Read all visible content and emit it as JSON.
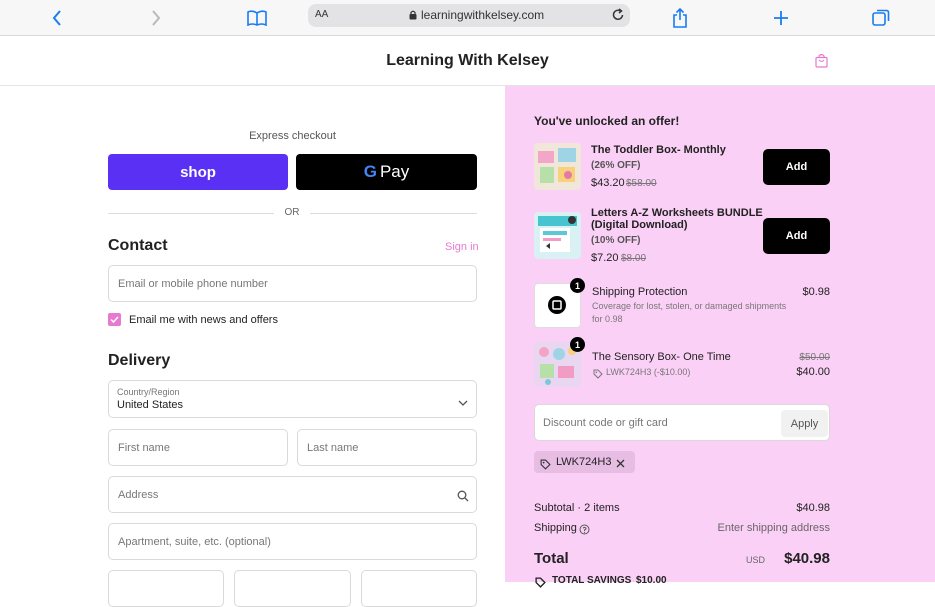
{
  "browser": {
    "aa_label": "AA",
    "url": "learningwithkelsey.com"
  },
  "store": {
    "title": "Learning With Kelsey"
  },
  "express": {
    "label": "Express checkout",
    "shop_label": "shop",
    "gpay_label": "Pay",
    "or_label": "OR"
  },
  "contact": {
    "heading": "Contact",
    "signin_label": "Sign in",
    "email_placeholder": "Email or mobile phone number",
    "newsletter_label": "Email me with news and offers",
    "newsletter_checked": true
  },
  "delivery": {
    "heading": "Delivery",
    "country_label": "Country/Region",
    "country_value": "United States",
    "first_name_placeholder": "First name",
    "last_name_placeholder": "Last name",
    "address_placeholder": "Address",
    "apartment_placeholder": "Apartment, suite, etc. (optional)"
  },
  "offers": {
    "heading": "You've unlocked an offer!",
    "items": [
      {
        "title": "The Toddler Box- Monthly",
        "discount": "(26% OFF)",
        "price": "$43.20",
        "old_price": "$58.00",
        "button": "Add"
      },
      {
        "title_line1": "Letters A-Z Worksheets BUNDLE",
        "title_line2": "(Digital Download)",
        "discount": "(10% OFF)",
        "price": "$7.20",
        "old_price": "$8.00",
        "button": "Add"
      }
    ]
  },
  "cart": {
    "lines": [
      {
        "qty": "1",
        "name": "Shipping Protection",
        "sub_line1": "Coverage for lost, stolen, or damaged shipments",
        "sub_line2": "for 0.98",
        "price": "$0.98"
      },
      {
        "qty": "1",
        "name": "The Sensory Box- One Time",
        "code": "LWK724H3 (-$10.00)",
        "old_price": "$50.00",
        "price": "$40.00"
      }
    ]
  },
  "discount": {
    "placeholder": "Discount code or gift card",
    "apply_label": "Apply",
    "applied_code": "LWK724H3"
  },
  "summary": {
    "subtotal_label": "Subtotal · 2 items",
    "subtotal_value": "$40.98",
    "shipping_label": "Shipping",
    "shipping_value": "Enter shipping address",
    "total_label": "Total",
    "currency": "USD",
    "total_value": "$40.98",
    "savings_label": "TOTAL SAVINGS",
    "savings_value": "$10.00"
  },
  "colors": {
    "accent_pink": "#e77ad0",
    "summary_bg": "#fbd0f6",
    "shop_purple": "#5a31f4",
    "safari_blue": "#1a7cf0"
  }
}
